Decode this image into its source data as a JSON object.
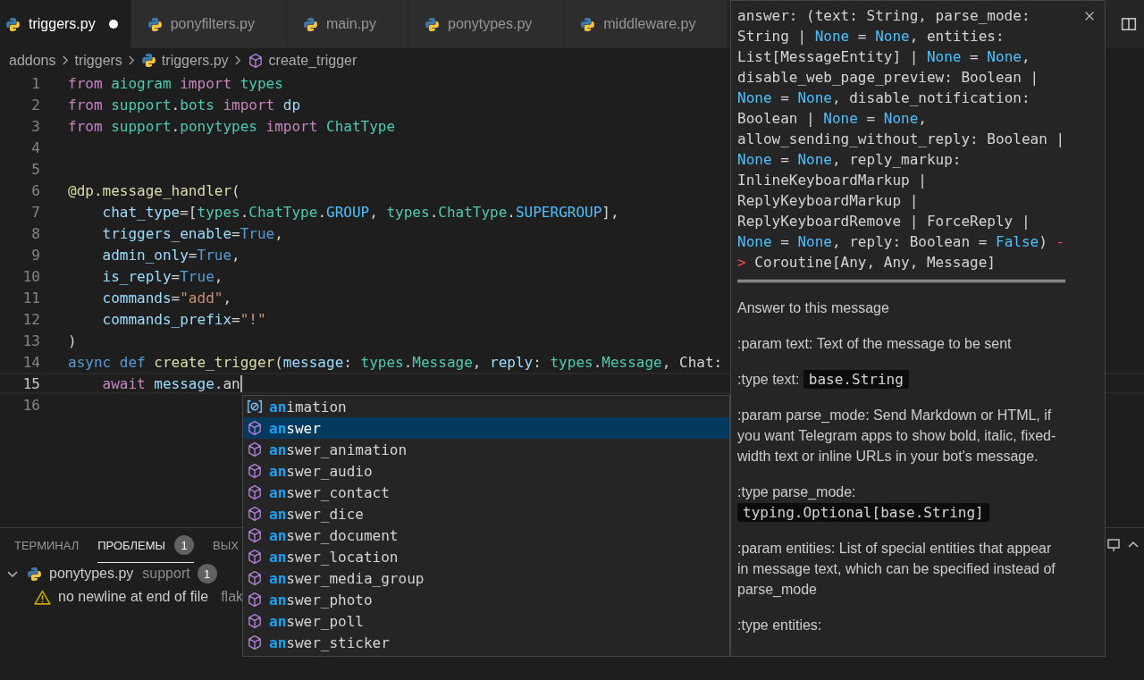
{
  "tabs": [
    {
      "label": "triggers.py",
      "selected": true,
      "modified": true
    },
    {
      "label": "ponyfilters.py",
      "selected": false,
      "modified": false
    },
    {
      "label": "main.py",
      "selected": false,
      "modified": false
    },
    {
      "label": "ponytypes.py",
      "selected": false,
      "modified": false
    },
    {
      "label": "middleware.py",
      "selected": false,
      "modified": false
    }
  ],
  "breadcrumb": [
    {
      "label": "addons",
      "kind": "folder"
    },
    {
      "label": "triggers",
      "kind": "folder"
    },
    {
      "label": "triggers.py",
      "kind": "file"
    },
    {
      "label": "create_trigger",
      "kind": "method"
    }
  ],
  "lines": [
    {
      "number": "1",
      "current": false,
      "tokens": [
        {
          "kind": "kw",
          "t": "from "
        },
        {
          "kind": "mod",
          "t": "aiogram "
        },
        {
          "kind": "kw",
          "t": "import "
        },
        {
          "kind": "mod",
          "t": "types"
        }
      ]
    },
    {
      "number": "2",
      "current": false,
      "tokens": [
        {
          "kind": "kw",
          "t": "from "
        },
        {
          "kind": "mod",
          "t": "support"
        },
        {
          "kind": "plain",
          "t": "."
        },
        {
          "kind": "mod",
          "t": "bots "
        },
        {
          "kind": "kw",
          "t": "import "
        },
        {
          "kind": "var",
          "t": "dp"
        }
      ]
    },
    {
      "number": "3",
      "current": false,
      "tokens": [
        {
          "kind": "kw",
          "t": "from "
        },
        {
          "kind": "mod",
          "t": "support"
        },
        {
          "kind": "plain",
          "t": "."
        },
        {
          "kind": "mod",
          "t": "ponytypes "
        },
        {
          "kind": "kw",
          "t": "import "
        },
        {
          "kind": "mod",
          "t": "ChatType"
        }
      ]
    },
    {
      "number": "4",
      "current": false
    },
    {
      "number": "5",
      "current": false
    },
    {
      "number": "6",
      "current": false,
      "tokens": [
        {
          "kind": "fn",
          "t": "@dp.message_handler"
        },
        {
          "kind": "plain",
          "t": "("
        }
      ]
    },
    {
      "number": "7",
      "current": false,
      "tokens": [
        {
          "kind": "var",
          "t": "    chat_type"
        },
        {
          "kind": "plain",
          "t": "=["
        },
        {
          "kind": "mod",
          "t": "types"
        },
        {
          "kind": "plain",
          "t": "."
        },
        {
          "kind": "mod",
          "t": "ChatType"
        },
        {
          "kind": "plain",
          "t": "."
        },
        {
          "kind": "const",
          "t": "GROUP"
        },
        {
          "kind": "plain",
          "t": ", "
        },
        {
          "kind": "mod",
          "t": "types"
        },
        {
          "kind": "plain",
          "t": "."
        },
        {
          "kind": "mod",
          "t": "ChatType"
        },
        {
          "kind": "plain",
          "t": "."
        },
        {
          "kind": "const",
          "t": "SUPERGROUP"
        },
        {
          "kind": "plain",
          "t": "],"
        }
      ]
    },
    {
      "number": "8",
      "current": false,
      "tokens": [
        {
          "kind": "var",
          "t": "    triggers_enable"
        },
        {
          "kind": "plain",
          "t": "="
        },
        {
          "kind": "bool",
          "t": "True"
        },
        {
          "kind": "plain",
          "t": ","
        }
      ]
    },
    {
      "number": "9",
      "current": false,
      "tokens": [
        {
          "kind": "var",
          "t": "    admin_only"
        },
        {
          "kind": "plain",
          "t": "="
        },
        {
          "kind": "bool",
          "t": "True"
        },
        {
          "kind": "plain",
          "t": ","
        }
      ]
    },
    {
      "number": "10",
      "current": false,
      "tokens": [
        {
          "kind": "var",
          "t": "    is_reply"
        },
        {
          "kind": "plain",
          "t": "="
        },
        {
          "kind": "bool",
          "t": "True"
        },
        {
          "kind": "plain",
          "t": ","
        }
      ]
    },
    {
      "number": "11",
      "current": false,
      "tokens": [
        {
          "kind": "var",
          "t": "    commands"
        },
        {
          "kind": "plain",
          "t": "="
        },
        {
          "kind": "str",
          "t": "\"add\""
        },
        {
          "kind": "plain",
          "t": ","
        }
      ]
    },
    {
      "number": "12",
      "current": false,
      "tokens": [
        {
          "kind": "var",
          "t": "    commands_prefix"
        },
        {
          "kind": "plain",
          "t": "="
        },
        {
          "kind": "str",
          "t": "\"!\""
        }
      ]
    },
    {
      "number": "13",
      "current": false,
      "tokens": [
        {
          "kind": "plain",
          "t": ")"
        }
      ]
    },
    {
      "number": "14",
      "current": false,
      "tokens": [
        {
          "kind": "bool",
          "t": "async def "
        },
        {
          "kind": "fn",
          "t": "create_trigger"
        },
        {
          "kind": "plain",
          "t": "("
        },
        {
          "kind": "var",
          "t": "message"
        },
        {
          "kind": "plain",
          "t": ": "
        },
        {
          "kind": "mod",
          "t": "types"
        },
        {
          "kind": "plain",
          "t": "."
        },
        {
          "kind": "mod",
          "t": "Message"
        },
        {
          "kind": "plain",
          "t": ", "
        },
        {
          "kind": "var",
          "t": "reply"
        },
        {
          "kind": "plain",
          "t": ": "
        },
        {
          "kind": "mod",
          "t": "types"
        },
        {
          "kind": "plain",
          "t": "."
        },
        {
          "kind": "mod",
          "t": "Message"
        },
        {
          "kind": "plain",
          "t": ", "
        },
        {
          "kind": "plain",
          "t": "Chat:"
        }
      ]
    },
    {
      "number": "15",
      "current": true,
      "tokens": [
        {
          "kind": "kw",
          "t": "    await "
        },
        {
          "kind": "var",
          "t": "message"
        },
        {
          "kind": "plain",
          "t": ".an"
        }
      ]
    },
    {
      "number": "16",
      "current": false
    }
  ],
  "panel": {
    "tabs": [
      {
        "label": "ТЕРМИНАЛ",
        "selected": false
      },
      {
        "label": "ПРОБЛЕМЫ",
        "selected": true,
        "badge": "1"
      },
      {
        "label": "ВЫХ",
        "selected": false
      }
    ],
    "group": {
      "file": "ponytypes.py",
      "folder": "support",
      "count": "1",
      "expanded": true,
      "problems": [
        {
          "kind": "warning",
          "message": "no newline at end of file",
          "source": "flak"
        }
      ]
    }
  },
  "suggest": {
    "items": [
      {
        "kind": "field",
        "match": "an",
        "rest": "imation",
        "selected": false
      },
      {
        "kind": "method",
        "match": "an",
        "rest": "swer",
        "selected": true
      },
      {
        "kind": "method",
        "match": "an",
        "rest": "swer_animation",
        "selected": false
      },
      {
        "kind": "method",
        "match": "an",
        "rest": "swer_audio",
        "selected": false
      },
      {
        "kind": "method",
        "match": "an",
        "rest": "swer_contact",
        "selected": false
      },
      {
        "kind": "method",
        "match": "an",
        "rest": "swer_dice",
        "selected": false
      },
      {
        "kind": "method",
        "match": "an",
        "rest": "swer_document",
        "selected": false
      },
      {
        "kind": "method",
        "match": "an",
        "rest": "swer_location",
        "selected": false
      },
      {
        "kind": "method",
        "match": "an",
        "rest": "swer_media_group",
        "selected": false
      },
      {
        "kind": "method",
        "match": "an",
        "rest": "swer_photo",
        "selected": false
      },
      {
        "kind": "method",
        "match": "an",
        "rest": "swer_poll",
        "selected": false
      },
      {
        "kind": "method",
        "match": "an",
        "rest": "swer_sticker",
        "selected": false
      }
    ]
  },
  "details": {
    "signature": [
      [
        {
          "kind": "plain",
          "t": "answer: (text: String, parse_mode:"
        }
      ],
      [
        {
          "kind": "plain",
          "t": "String | "
        },
        {
          "kind": "const",
          "t": "None"
        },
        {
          "kind": "plain",
          "t": " = "
        },
        {
          "kind": "const",
          "t": "None"
        },
        {
          "kind": "plain",
          "t": ", entities:"
        }
      ],
      [
        {
          "kind": "plain",
          "t": "List[MessageEntity] | "
        },
        {
          "kind": "const",
          "t": "None"
        },
        {
          "kind": "plain",
          "t": " = "
        },
        {
          "kind": "const",
          "t": "None"
        },
        {
          "kind": "plain",
          "t": ","
        }
      ],
      [
        {
          "kind": "plain",
          "t": "disable_web_page_preview: Boolean |"
        }
      ],
      [
        {
          "kind": "const",
          "t": "None"
        },
        {
          "kind": "plain",
          "t": " = "
        },
        {
          "kind": "const",
          "t": "None"
        },
        {
          "kind": "plain",
          "t": ", disable_notification:"
        }
      ],
      [
        {
          "kind": "plain",
          "t": "Boolean | "
        },
        {
          "kind": "const",
          "t": "None"
        },
        {
          "kind": "plain",
          "t": " = "
        },
        {
          "kind": "const",
          "t": "None"
        },
        {
          "kind": "plain",
          "t": ","
        }
      ],
      [
        {
          "kind": "plain",
          "t": "allow_sending_without_reply: Boolean |"
        }
      ],
      [
        {
          "kind": "const",
          "t": "None"
        },
        {
          "kind": "plain",
          "t": " = "
        },
        {
          "kind": "const",
          "t": "None"
        },
        {
          "kind": "plain",
          "t": ", reply_markup:"
        }
      ],
      [
        {
          "kind": "plain",
          "t": "InlineKeyboardMarkup |"
        }
      ],
      [
        {
          "kind": "plain",
          "t": "ReplyKeyboardMarkup |"
        }
      ],
      [
        {
          "kind": "plain",
          "t": "ReplyKeyboardRemove | ForceReply |"
        }
      ],
      [
        {
          "kind": "const",
          "t": "None"
        },
        {
          "kind": "plain",
          "t": " = "
        },
        {
          "kind": "const",
          "t": "None"
        },
        {
          "kind": "plain",
          "t": ", reply: Boolean = "
        },
        {
          "kind": "const",
          "t": "False"
        },
        {
          "kind": "plain",
          "t": ") "
        },
        {
          "kind": "arrow",
          "t": "-"
        }
      ],
      [
        {
          "kind": "arrow",
          "t": ">"
        },
        {
          "kind": "plain",
          "t": " Coroutine[Any, Any, Message]"
        }
      ]
    ],
    "docs": [
      {
        "text": "Answer to this message"
      },
      {
        "text": ":param text: Text of the message to be sent"
      },
      {
        "text": ":type text:",
        "code": "base.String"
      },
      {
        "text": ":param parse_mode: Send Markdown or HTML, if you want Telegram apps to show bold, italic, fixed-width text or inline URLs in your bot's message."
      },
      {
        "text": ":type parse_mode:",
        "code": "typing.Optional[base.String]"
      },
      {
        "text": ":param entities: List of special entities that appear in message text, which can be specified instead of parse_mode"
      },
      {
        "text": ":type entities:"
      }
    ]
  }
}
